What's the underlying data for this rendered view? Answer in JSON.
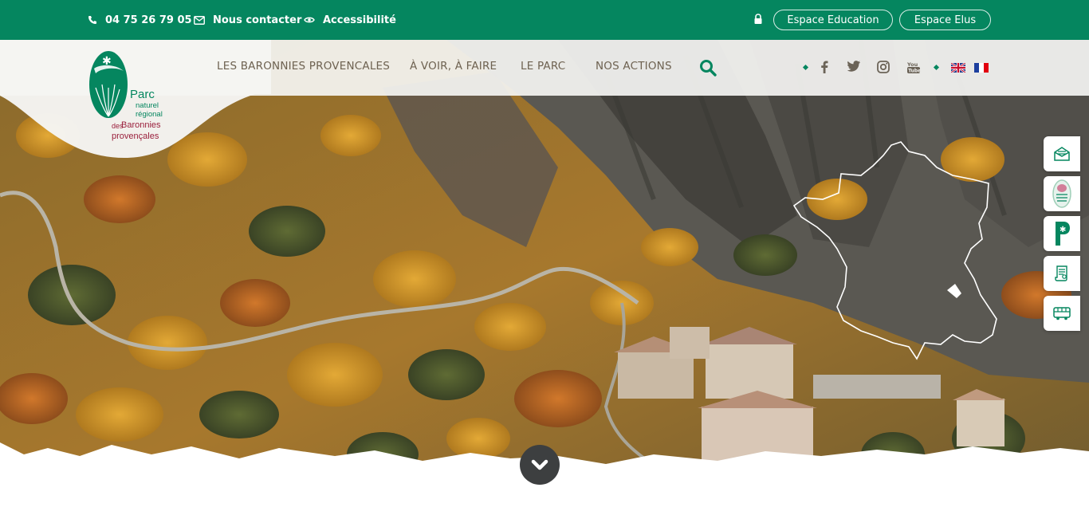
{
  "topbar": {
    "phone": "04 75 26 79 05",
    "contact_label": "Nous contacter",
    "accessibility_label": "Accessibilité",
    "education_label": "Espace Education",
    "elus_label": "Espace Elus"
  },
  "logo": {
    "line1": "Parc",
    "line2": "naturel",
    "line3": "régional",
    "line4": "des",
    "line5": "Baronnies",
    "line6": "provençales"
  },
  "nav": {
    "items": [
      {
        "label": "LES BARONNIES PROVENCALES"
      },
      {
        "label": "À VOIR, À FAIRE"
      },
      {
        "label": "LE PARC"
      },
      {
        "label": "NOS ACTIONS"
      }
    ]
  },
  "social": [
    "facebook-icon",
    "twitter-icon",
    "instagram-icon",
    "youtube-icon"
  ],
  "languages": [
    "english-flag",
    "french-flag"
  ],
  "side_tabs": [
    "newsletter-icon",
    "parc-label-icon",
    "brand-p-icon",
    "document-icon",
    "bus-icon"
  ],
  "colors": {
    "brand_green": "#05865f",
    "nav_text": "#6e6251",
    "logo_red": "#9a1f3c",
    "scroll_button": "#3d3f40"
  }
}
